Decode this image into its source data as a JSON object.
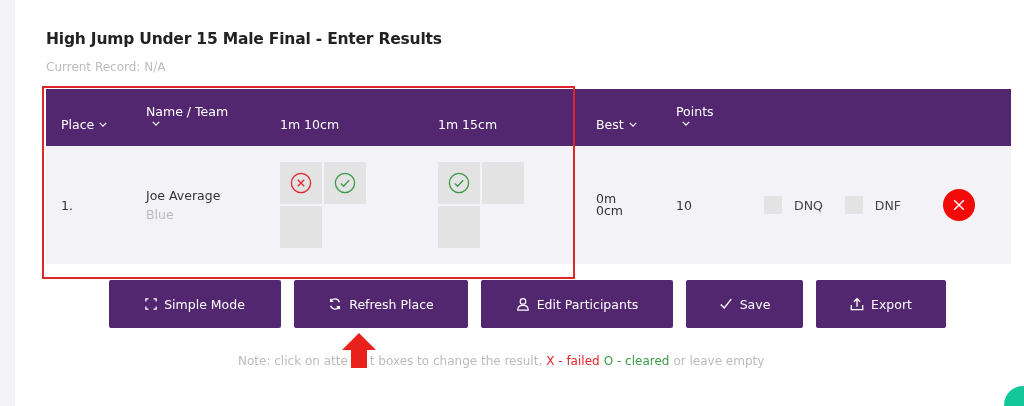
{
  "title": "High Jump Under 15 Male Final - Enter Results",
  "record": "Current Record: N/A",
  "table": {
    "columns": [
      {
        "label": "Place",
        "sortable": true
      },
      {
        "label": "Name / Team",
        "sortable": true
      },
      {
        "label": "1m 10cm",
        "sortable": false
      },
      {
        "label": "1m 15cm",
        "sortable": false
      },
      {
        "label": "Best",
        "sortable": true
      },
      {
        "label": "Points",
        "sortable": true
      }
    ],
    "rows": [
      {
        "place": "1.",
        "name": "Joe Average",
        "team": "Blue",
        "heights": [
          [
            {
              "kind": "failed"
            },
            {
              "kind": "cleared"
            },
            {
              "kind": "empty"
            }
          ],
          [
            {
              "kind": "cleared"
            },
            {
              "kind": "empty"
            },
            {
              "kind": "empty"
            }
          ]
        ],
        "best": [
          "0m",
          "0cm"
        ],
        "points": "10",
        "flags": [
          {
            "label": "DNQ",
            "checked": false
          },
          {
            "label": "DNF",
            "checked": false
          }
        ]
      }
    ]
  },
  "buttons": [
    {
      "label": "Simple Mode"
    },
    {
      "label": "Refresh Place"
    },
    {
      "label": "Edit Participants"
    },
    {
      "label": "Save"
    },
    {
      "label": "Export"
    }
  ],
  "note": [
    {
      "text": "Note: click on atte",
      "kind": "plain"
    },
    {
      "text": "t boxes to change the result,",
      "kind": "plain"
    },
    {
      "text": "X - failed",
      "kind": "failed"
    },
    {
      "text": "O - cleared",
      "kind": "cleared"
    },
    {
      "text": "or leave empty",
      "kind": "plain"
    }
  ]
}
